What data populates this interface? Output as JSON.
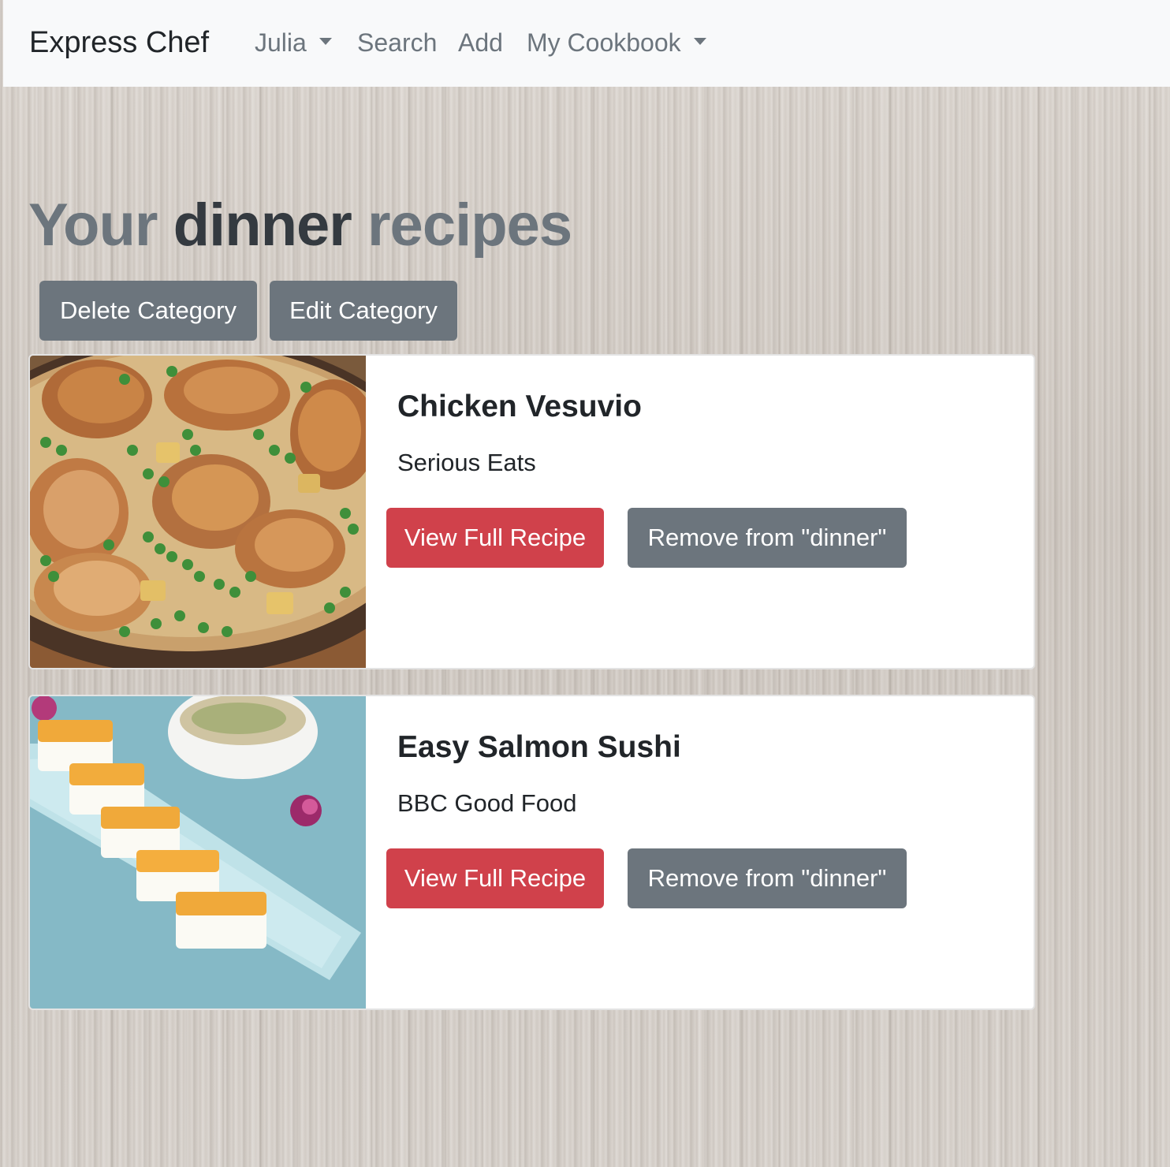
{
  "navbar": {
    "brand": "Express Chef",
    "items": [
      {
        "label": "Julia",
        "dropdown": true
      },
      {
        "label": "Search",
        "dropdown": false
      },
      {
        "label": "Add",
        "dropdown": false
      },
      {
        "label": "My Cookbook",
        "dropdown": true
      }
    ]
  },
  "heading": {
    "prefix": "Your",
    "category": "dinner",
    "suffix": "recipes"
  },
  "category_actions": {
    "delete_label": "Delete Category",
    "edit_label": "Edit Category"
  },
  "recipes": [
    {
      "title": "Chicken Vesuvio",
      "source": "Serious Eats",
      "view_label": "View Full Recipe",
      "remove_label": "Remove from \"dinner\""
    },
    {
      "title": "Easy Salmon Sushi",
      "source": "BBC Good Food",
      "view_label": "View Full Recipe",
      "remove_label": "Remove from \"dinner\""
    }
  ],
  "colors": {
    "navbar_bg": "#f8f9fa",
    "btn_secondary": "#6c757d",
    "btn_danger": "#d0414b",
    "heading_muted": "#6c757d",
    "heading_strong": "#343a40"
  }
}
